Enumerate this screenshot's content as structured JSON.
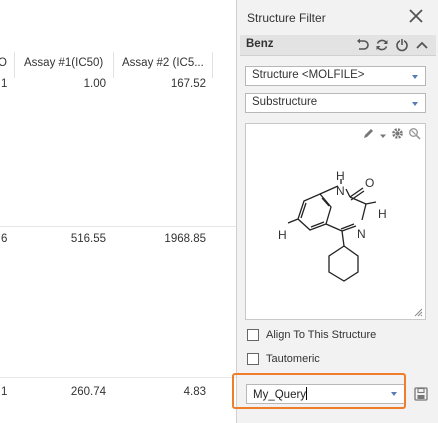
{
  "grid": {
    "columns": [
      "O",
      "Assay #1(IC50)",
      "Assay #2 (IC5..."
    ],
    "rows": [
      {
        "c1": "1",
        "c2": "1.00",
        "c3": "167.52"
      },
      {
        "c1": "6",
        "c2": "516.55",
        "c3": "1968.85"
      },
      {
        "c1": "1",
        "c2": "260.74",
        "c3": "4.83"
      }
    ]
  },
  "panel": {
    "title": "Structure Filter",
    "filter_name": "Benz",
    "format_select": "Structure <MOLFILE>",
    "search_type_select": "Substructure",
    "molecule_labels": {
      "H_top": "H",
      "N_top": "N",
      "O": "O",
      "H_right": "H",
      "N_mid": "N",
      "H_left": "H"
    },
    "align_label": "Align To This Structure",
    "tautomeric_label": "Tautomeric",
    "query_name": "My_Query"
  },
  "colors": {
    "highlight": "#f07d2a",
    "dropdown_arrow": "#5b7bb5"
  }
}
